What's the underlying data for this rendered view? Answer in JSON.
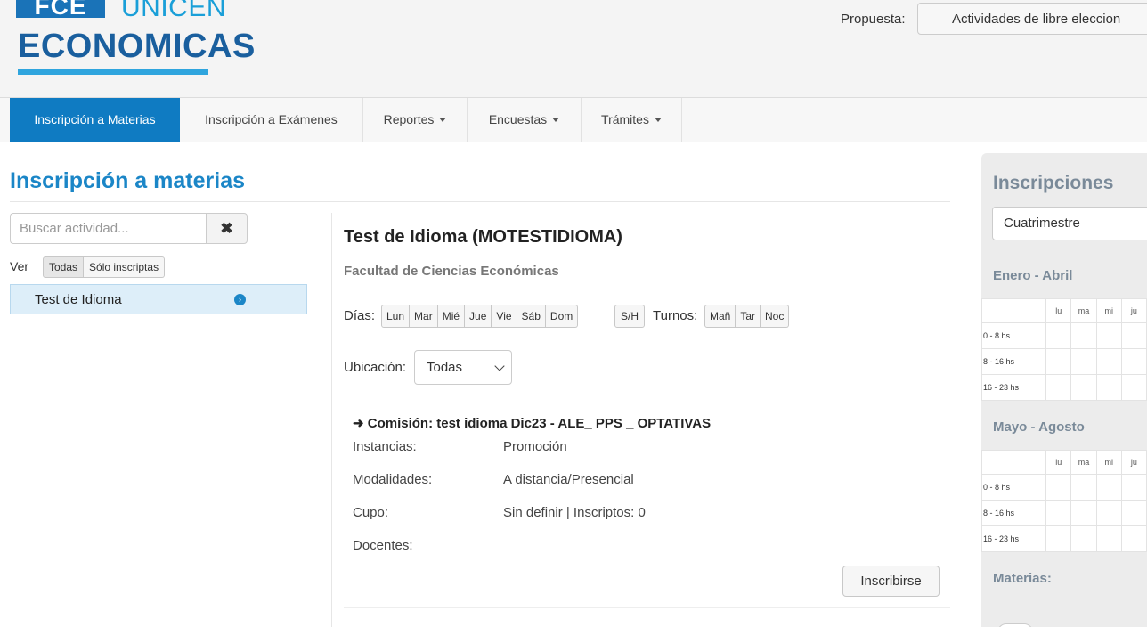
{
  "logo": {
    "box_text": "FCE",
    "unicen_text": "UNICEN",
    "eco_text": "ECONOMICAS",
    "colors": {
      "primary": "#1a73b8",
      "accent": "#1a9fd8",
      "dark": "#1a5f9e"
    }
  },
  "header": {
    "propuesta_label": "Propuesta:",
    "propuesta_value": "Actividades de libre eleccion"
  },
  "nav": {
    "items": [
      {
        "label": "Inscripción a Materias",
        "active": true,
        "dropdown": false
      },
      {
        "label": "Inscripción a Exámenes",
        "active": false,
        "dropdown": false
      },
      {
        "label": "Reportes",
        "active": false,
        "dropdown": true
      },
      {
        "label": "Encuestas",
        "active": false,
        "dropdown": true
      },
      {
        "label": "Trámites",
        "active": false,
        "dropdown": true
      }
    ]
  },
  "page": {
    "title": "Inscripción a materias"
  },
  "search": {
    "placeholder": "Buscar actividad...",
    "clear_icon": "✖"
  },
  "filter": {
    "label": "Ver",
    "options": [
      "Todas",
      "Sólo inscriptas"
    ],
    "selected": "Todas"
  },
  "activities": [
    {
      "label": "Test de Idioma",
      "icon": "chevron-right-circle-icon"
    }
  ],
  "course": {
    "title": "Test de Idioma (MOTESTIDIOMA)",
    "faculty": "Facultad de Ciencias Económicas",
    "dias_label": "Días:",
    "dias": [
      "Lun",
      "Mar",
      "Mié",
      "Jue",
      "Vie",
      "Sáb",
      "Dom"
    ],
    "sh_label": "S/H",
    "turnos_label": "Turnos:",
    "turnos": [
      "Mañ",
      "Tar",
      "Noc"
    ],
    "ubicacion_label": "Ubicación:",
    "ubicacion_value": "Todas"
  },
  "comision": {
    "title": "➜ Comisión: test idioma Dic23 - ALE_ PPS _ OPTATIVAS",
    "rows": [
      {
        "label": "Instancias:",
        "value": "Promoción"
      },
      {
        "label": "Modalidades:",
        "value": "A distancia/Presencial"
      },
      {
        "label": "Cupo:",
        "value": "Sin definir | Inscriptos: 0"
      },
      {
        "label": "Docentes:",
        "value": ""
      }
    ],
    "button": "Inscribirse"
  },
  "right_panel": {
    "title": "Inscripciones",
    "select_value": "Cuatrimestre",
    "periods": [
      {
        "title": "Enero - Abril",
        "days": [
          "lu",
          "ma",
          "mi",
          "ju"
        ],
        "rows": [
          "0 - 8 hs",
          "8 - 16 hs",
          "16 - 23 hs"
        ]
      },
      {
        "title": "Mayo - Agosto",
        "days": [
          "lu",
          "ma",
          "mi",
          "ju"
        ],
        "rows": [
          "0 - 8 hs",
          "8 - 16 hs",
          "16 - 23 hs"
        ]
      }
    ],
    "materias_label": "Materias:"
  }
}
